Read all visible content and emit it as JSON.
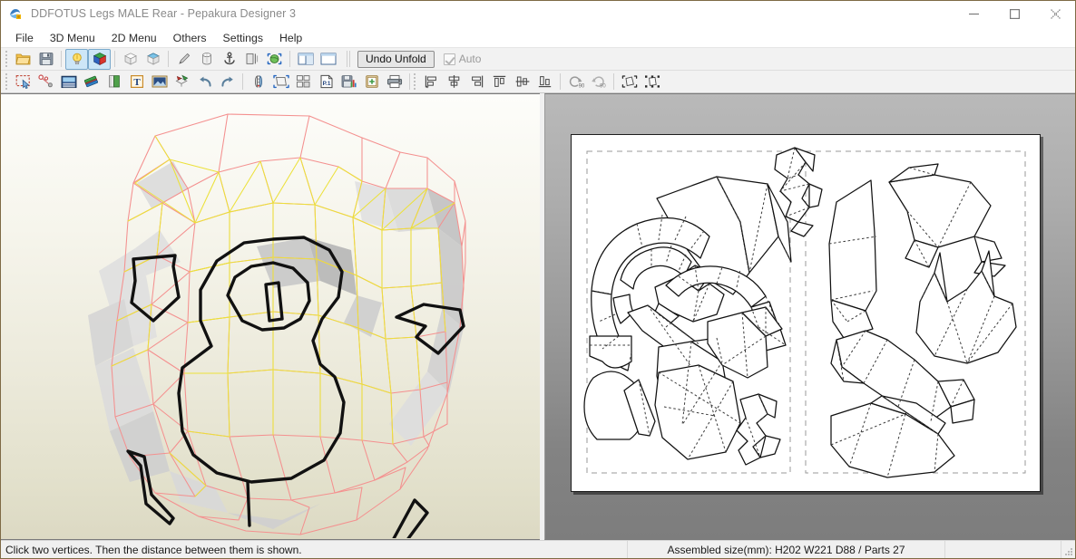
{
  "window": {
    "title": "DDFOTUS Legs MALE Rear - Pepakura Designer 3",
    "app_icon": "pepakura-app-icon",
    "controls": {
      "minimize": "minimize-icon",
      "maximize": "maximize-icon",
      "close": "close-icon"
    }
  },
  "menubar": {
    "items": [
      {
        "label": "File"
      },
      {
        "label": "3D Menu"
      },
      {
        "label": "2D Menu"
      },
      {
        "label": "Others"
      },
      {
        "label": "Settings"
      },
      {
        "label": "Help"
      }
    ]
  },
  "toolbar_main": {
    "groups": [
      {
        "buttons": [
          {
            "icon": "open-folder-icon",
            "tip": "Open",
            "active": false
          },
          {
            "icon": "save-floppy-icon",
            "tip": "Save",
            "active": false
          }
        ]
      },
      {
        "buttons": [
          {
            "icon": "lightbulb-icon",
            "tip": "Lighting",
            "active": true
          },
          {
            "icon": "rgb-cube-icon",
            "tip": "Texture",
            "active": true
          }
        ]
      },
      {
        "buttons": [
          {
            "icon": "white-cube-icon",
            "tip": "Flat shading",
            "active": false
          },
          {
            "icon": "blue-cube-icon",
            "tip": "Smooth shading",
            "active": false
          }
        ]
      },
      {
        "buttons": [
          {
            "icon": "pencil-icon",
            "tip": "Edit mode",
            "active": false
          },
          {
            "icon": "cylinder-icon",
            "tip": "Cylinder tool",
            "active": false
          },
          {
            "icon": "anchor-icon",
            "tip": "Anchor",
            "active": false
          },
          {
            "icon": "mirror-icon",
            "tip": "Mirror",
            "active": false
          },
          {
            "icon": "globe-select-icon",
            "tip": "Select all faces",
            "active": false
          }
        ]
      },
      {
        "buttons": [
          {
            "icon": "split-window-icon",
            "tip": "Split view",
            "active": false
          },
          {
            "icon": "single-window-icon",
            "tip": "Single view",
            "active": false
          }
        ]
      }
    ],
    "undo_unfold_label": "Undo Unfold",
    "auto_label": "Auto",
    "auto_checked": true,
    "auto_enabled": false
  },
  "toolbar_2d": {
    "groups": [
      {
        "buttons": [
          {
            "icon": "rectangle-select-icon",
            "tip": "Select"
          },
          {
            "icon": "join-edge-icon",
            "tip": "Join/Disjoin face"
          },
          {
            "icon": "tab-edit-icon",
            "tip": "Edit flap"
          },
          {
            "icon": "flap-style-icon",
            "tip": "Flap style"
          },
          {
            "icon": "line-edit-icon",
            "tip": "Edit line"
          },
          {
            "icon": "text-tool-icon",
            "tip": "Add text"
          },
          {
            "icon": "image-tool-icon",
            "tip": "Add picture"
          },
          {
            "icon": "unfold-icon",
            "tip": "Unfold"
          },
          {
            "icon": "undo-icon",
            "tip": "Undo"
          },
          {
            "icon": "redo-icon",
            "tip": "Redo"
          }
        ]
      },
      {
        "buttons": [
          {
            "icon": "mirror-part-icon",
            "tip": "Flip part"
          },
          {
            "icon": "move-part-icon",
            "tip": "Move part"
          },
          {
            "icon": "arrange-parts-icon",
            "tip": "Arrange parts"
          },
          {
            "icon": "page-number-icon",
            "tip": "Page P.1"
          },
          {
            "icon": "save-chart-icon",
            "tip": "Export"
          },
          {
            "icon": "clipboard-icon",
            "tip": "Copy to clipboard"
          },
          {
            "icon": "print-icon",
            "tip": "Print"
          }
        ]
      },
      {
        "buttons": [
          {
            "icon": "align-left-icon",
            "tip": "Align left"
          },
          {
            "icon": "align-center-icon",
            "tip": "Align center"
          },
          {
            "icon": "align-right-icon",
            "tip": "Align right"
          },
          {
            "icon": "align-top-icon",
            "tip": "Align top"
          },
          {
            "icon": "align-middle-icon",
            "tip": "Align middle"
          },
          {
            "icon": "align-bottom-icon",
            "tip": "Align bottom"
          }
        ]
      },
      {
        "buttons": [
          {
            "icon": "rotate-ccw-90-icon",
            "tip": "Rotate -90",
            "label": "90"
          },
          {
            "icon": "rotate-cw-90-icon",
            "tip": "Rotate 90",
            "label": "90"
          }
        ]
      },
      {
        "buttons": [
          {
            "icon": "fit-selection-icon",
            "tip": "Fit selection"
          },
          {
            "icon": "scale-part-icon",
            "tip": "Scale part"
          }
        ]
      }
    ]
  },
  "view_3d": {
    "name": "3d-model-view",
    "description": "Low-poly 3D model of male legs rear armor",
    "edge_color": "#f08b8b",
    "fold_color": "#e8e23c",
    "cut_color": "#111111",
    "face_color": "#ffffff"
  },
  "view_2d": {
    "name": "2d-unfold-view",
    "description": "Unfolded papercraft pattern page",
    "page_color": "#ffffff",
    "cut_color": "#111111",
    "fold_color": "#555555",
    "margin_guide_color": "#9a9a9a"
  },
  "statusbar": {
    "hint": "Click two vertices. Then the distance between them is shown.",
    "assembled_size": "Assembled size(mm): H202 W221 D88 / Parts 27",
    "right_cell": "",
    "resize_grip": "resize-grip-icon"
  }
}
